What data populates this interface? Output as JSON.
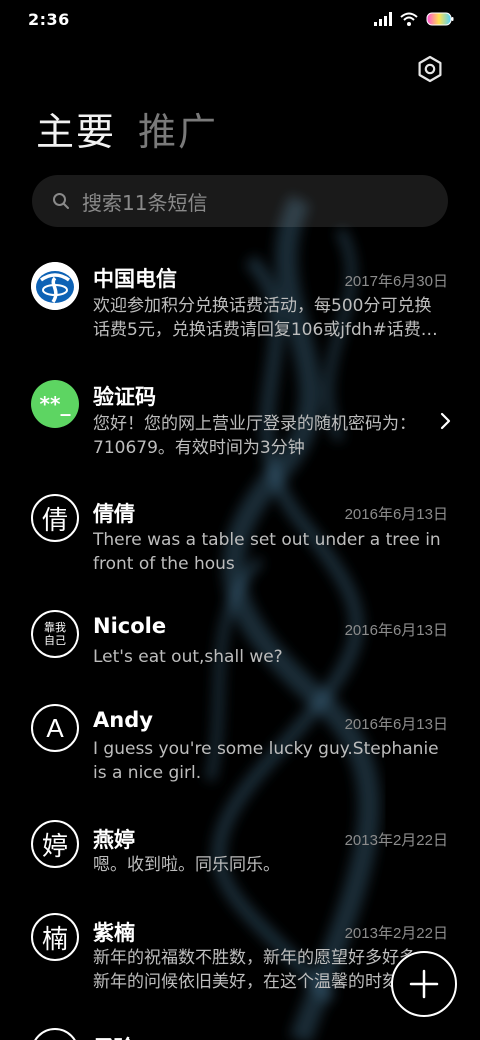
{
  "status_bar": {
    "time": "2:36"
  },
  "tabs": [
    {
      "label": "主要"
    },
    {
      "label": "推广"
    }
  ],
  "search": {
    "placeholder": "搜索11条短信"
  },
  "conversations": [
    {
      "name": "中国电信",
      "date": "2017年6月30日",
      "preview": "欢迎参加积分兑换话费活动，每500分可兑换话费5元，兑换话费请回复106或jfdh#话费…",
      "avatar": "china-telecom-logo"
    },
    {
      "name": "验证码",
      "date": "",
      "preview": "您好！您的网上营业厅登录的随机密码为：710679。有效时间为3分钟",
      "avatar_text": "**_",
      "avatar_color": "#5dd562"
    },
    {
      "name": "倩倩",
      "date": "2016年6月13日",
      "preview": "There was a table set out under a tree in front of the hous",
      "avatar_text": "倩"
    },
    {
      "name": "Nicole",
      "date": "2016年6月13日",
      "preview": "Let's eat out,shall we?",
      "avatar_text": "靠我自己"
    },
    {
      "name": "Andy",
      "date": "2016年6月13日",
      "preview": "I guess you're some lucky guy.Stephanie is a nice girl.",
      "avatar_text": "A"
    },
    {
      "name": "燕婷",
      "date": "2013年2月22日",
      "preview": "嗯。收到啦。同乐同乐。",
      "avatar_text": "婷"
    },
    {
      "name": "紫楠",
      "date": "2013年2月22日",
      "preview": "新年的祝福数不胜数，新年的愿望好多好多，新年的问候依旧美好，在这个温馨的时刻…",
      "avatar_text": "楠"
    },
    {
      "name": "子玲",
      "date": "",
      "preview": "",
      "avatar_text": ""
    }
  ],
  "colors": {
    "background": "#000000",
    "secondary_text": "#bdbdbd",
    "date_text": "#8c8c8c",
    "verify_green": "#5dd562",
    "telecom_blue": "#0d62b5"
  }
}
